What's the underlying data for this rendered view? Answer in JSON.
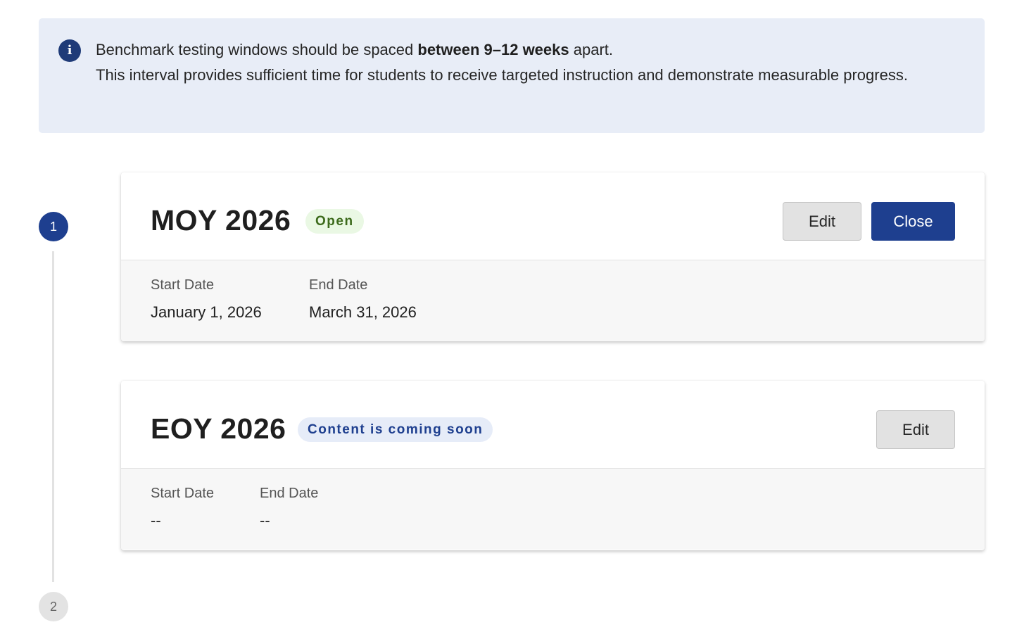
{
  "info_banner": {
    "icon": "info-icon",
    "text_before": "Benchmark testing windows should be spaced ",
    "text_bold": "between 9–12 weeks",
    "text_after": " apart.",
    "text_line2": "This interval provides sufficient time for students to receive targeted instruction and demonstrate measurable progress.",
    "colors": {
      "background": "#e8edf7",
      "icon": "#1f3b78"
    }
  },
  "timeline": {
    "steps": [
      {
        "number": "1",
        "state": "active"
      },
      {
        "number": "2",
        "state": "inactive"
      }
    ]
  },
  "windows": [
    {
      "title": "MOY 2026",
      "status": "Open",
      "edit_label": "Edit",
      "close_label": "Close",
      "start_label": "Start Date",
      "start_value": "January 1, 2026",
      "end_label": "End Date",
      "end_value": "March 31, 2026"
    },
    {
      "title": "EOY 2026",
      "status": "Content is coming soon",
      "edit_label": "Edit",
      "start_label": "Start Date",
      "start_value": "--",
      "end_label": "End Date",
      "end_value": "--"
    }
  ],
  "colors": {
    "primary": "#1e3f8f",
    "open_badge_bg": "#eaf8e4",
    "open_badge_text": "#3d6b1c",
    "soon_badge_bg": "#e6ecf8",
    "soon_badge_text": "#1e3f8f"
  }
}
